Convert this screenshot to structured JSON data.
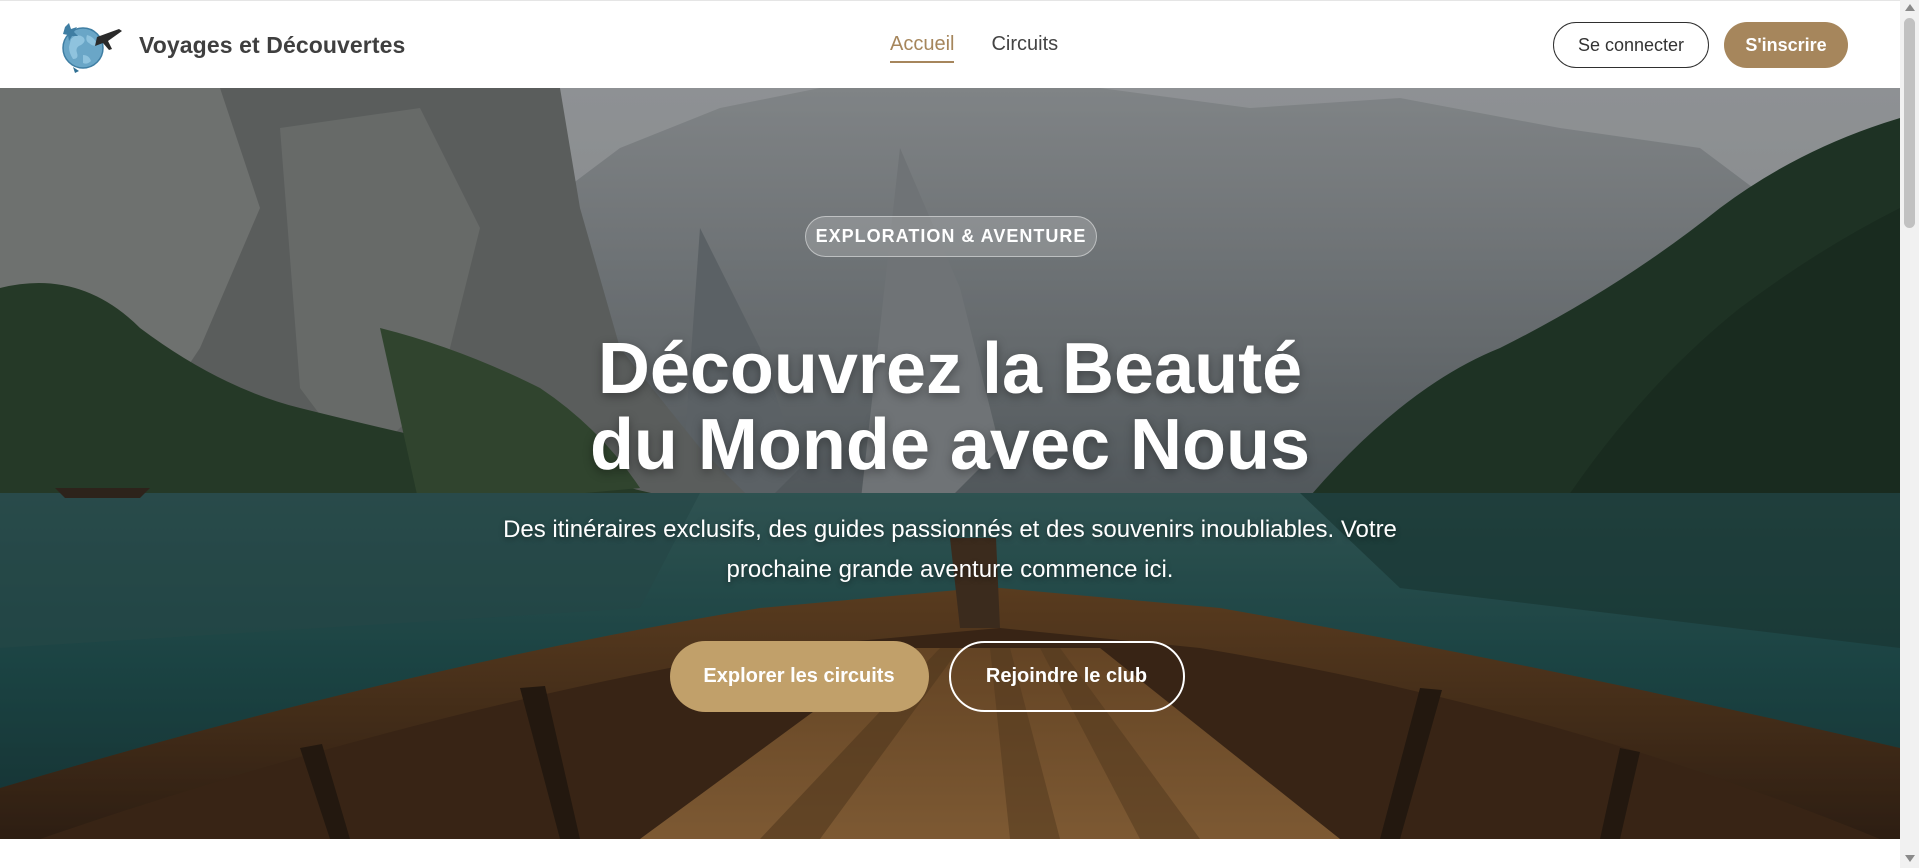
{
  "header": {
    "brand_name": "Voyages et Découvertes",
    "nav": [
      {
        "label": "Accueil",
        "active": true
      },
      {
        "label": "Circuits",
        "active": false
      }
    ],
    "login_label": "Se connecter",
    "signup_label": "S'inscrire"
  },
  "hero": {
    "badge": "EXPLORATION & AVENTURE",
    "title_line1": "Découvrez la Beauté",
    "title_line2": "du Monde avec Nous",
    "subtitle": "Des itinéraires exclusifs, des guides passionnés et des souvenirs inoubliables. Votre prochaine grande aventure commence ici.",
    "primary_cta": "Explorer les circuits",
    "secondary_cta": "Rejoindre le club"
  },
  "colors": {
    "accent": "#a6865c",
    "primary_button": "#c1a06a"
  },
  "icons": {
    "logo": "globe-airplane-logo"
  }
}
